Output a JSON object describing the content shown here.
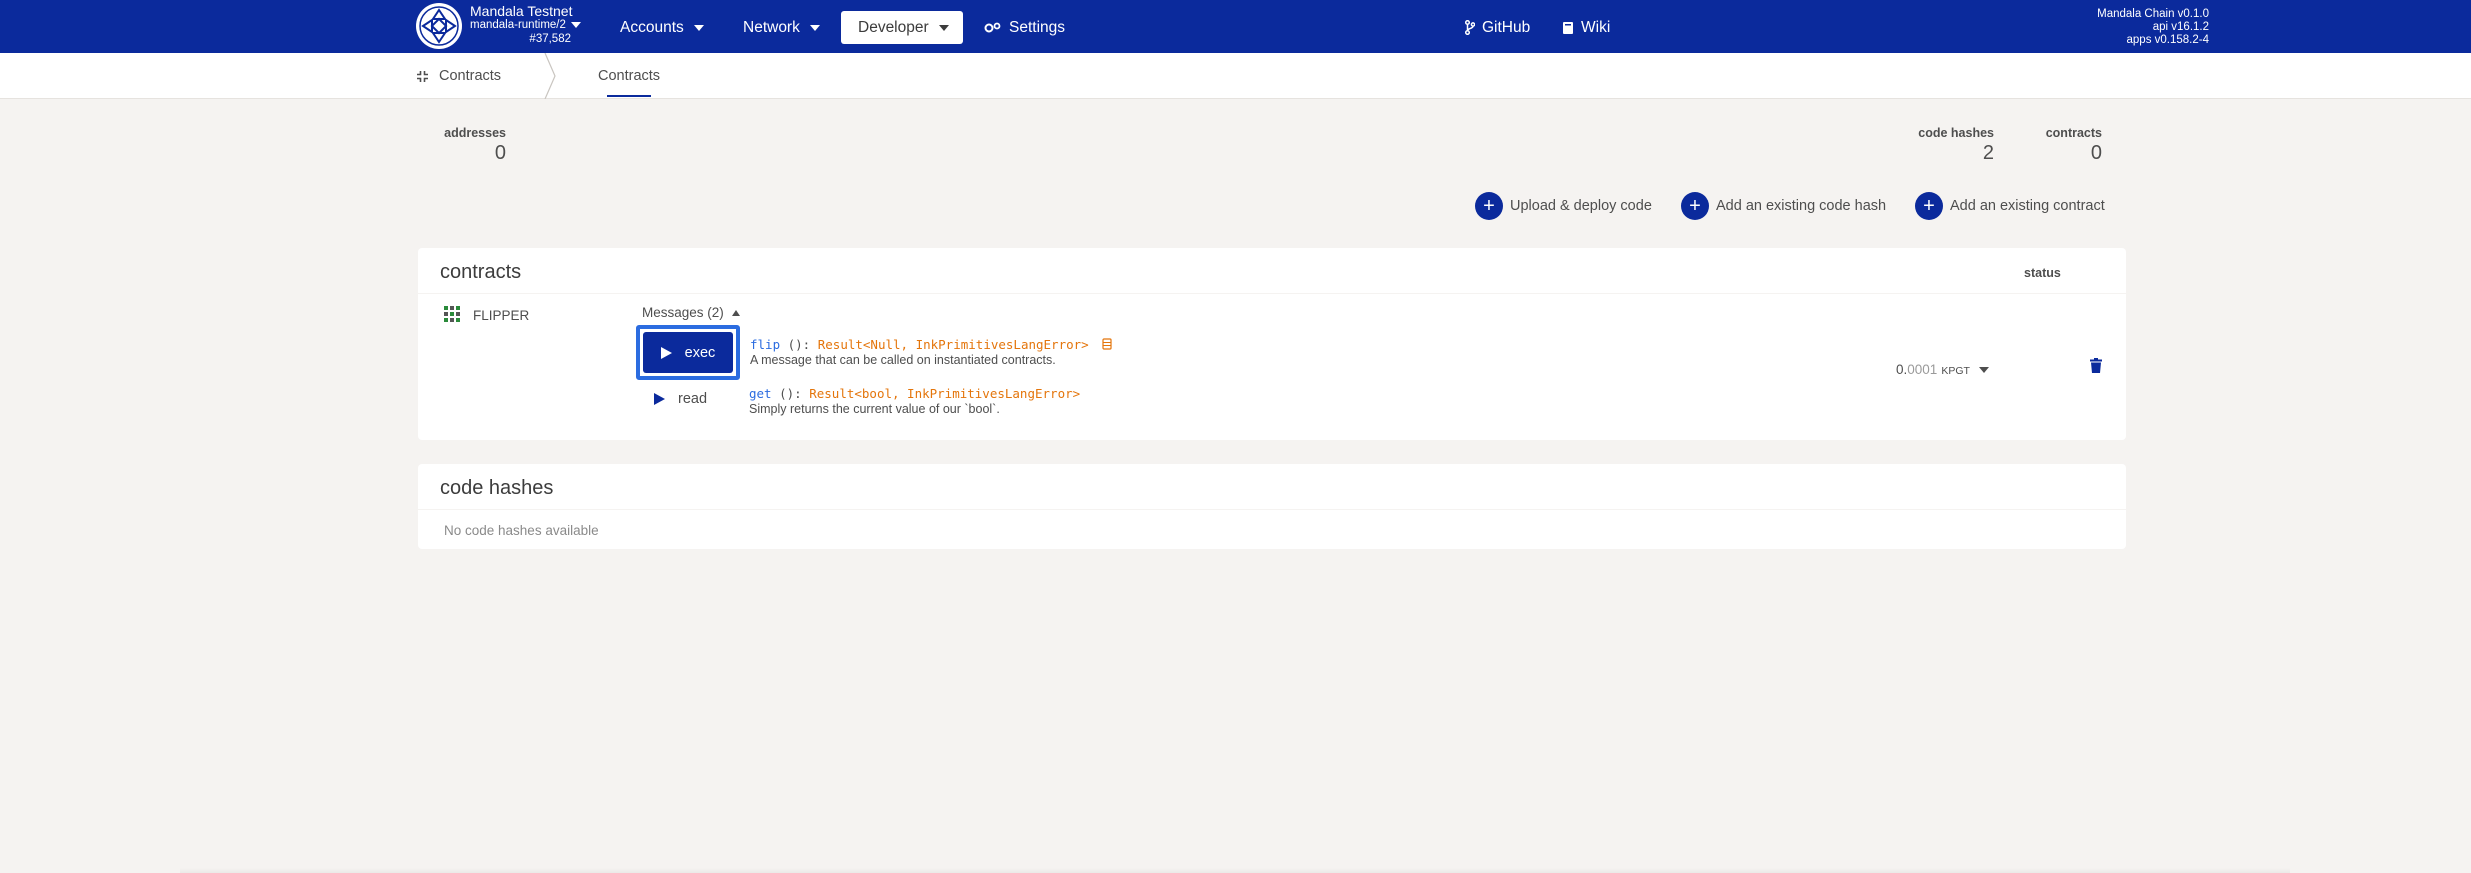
{
  "colors": {
    "brand": "#0b2a9c",
    "highlight": "#2b6ce0",
    "type_orange": "#e4750b"
  },
  "chain": {
    "name": "Mandala Testnet",
    "runtime": "mandala-runtime/2",
    "block": "#37,582",
    "logo_icon": "mandala-logo-icon"
  },
  "nav": {
    "accounts": "Accounts",
    "network": "Network",
    "developer": "Developer",
    "settings": "Settings",
    "github": "GitHub",
    "wiki": "Wiki"
  },
  "versions": {
    "chain": "Mandala Chain v0.1.0",
    "api": "api v16.1.2",
    "apps": "apps v0.158.2-4"
  },
  "subnav": {
    "title": "Contracts",
    "tab": "Contracts"
  },
  "summary": {
    "addresses_label": "addresses",
    "addresses_value": "0",
    "code_hashes_label": "code hashes",
    "code_hashes_value": "2",
    "contracts_label": "contracts",
    "contracts_value": "0"
  },
  "actions": {
    "upload": "Upload & deploy code",
    "add_code_hash": "Add an existing code hash",
    "add_contract": "Add an existing contract"
  },
  "contracts_table": {
    "title": "contracts",
    "status_col": "status",
    "rows": [
      {
        "name": "FLIPPER",
        "messages_toggle": "Messages (2)",
        "messages": [
          {
            "button": "exec",
            "fn": "flip",
            "args": " (): ",
            "returns": "Result<Null, InkPrimitivesLangError>",
            "doc": "A message that can be called on instantiated contracts."
          },
          {
            "button": "read",
            "fn": "get",
            "args": " (): ",
            "returns": "Result<bool, InkPrimitivesLangError>",
            "doc": "Simply returns the current value of our `bool`."
          }
        ],
        "balance_int": "0.",
        "balance_dec": "0001",
        "balance_unit": "KPGT"
      }
    ]
  },
  "code_hashes_table": {
    "title": "code hashes",
    "empty": "No code hashes available"
  }
}
